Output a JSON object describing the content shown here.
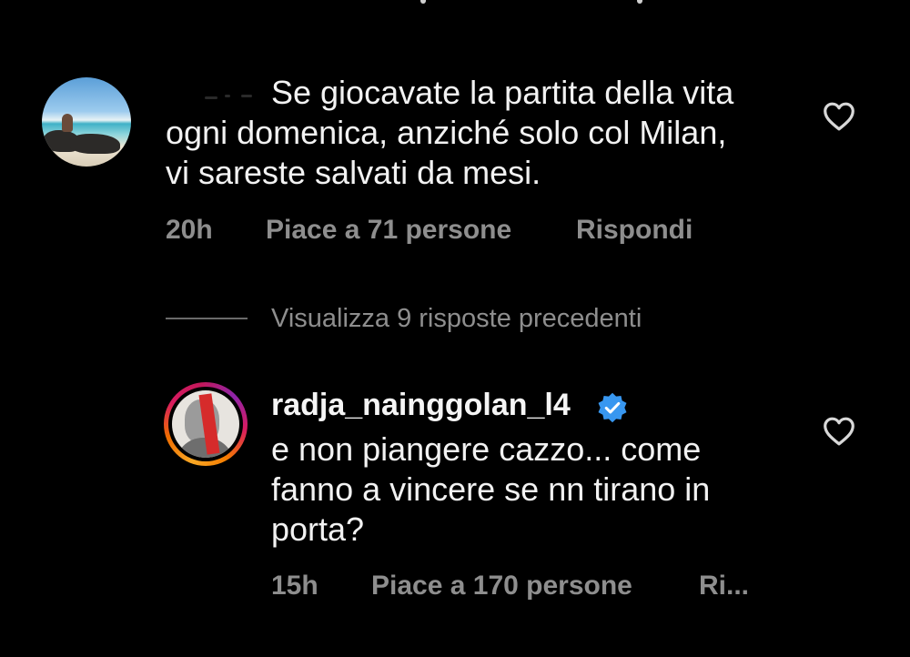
{
  "comments": [
    {
      "username": "",
      "text": "Se giocavate la partita della vita ogni domenica, anziché solo col Milan, vi sareste salvati da mesi.",
      "text_lines": [
        "Se giocavate la partita della vita",
        "ogni domenica, anziché solo col Milan,",
        "vi sareste salvati da mesi."
      ],
      "time": "20h",
      "likes": "Piace a 71 persone",
      "reply": "Rispondi",
      "liked": false,
      "icons": {
        "avatar": "avatar",
        "like": "heart-outline-icon"
      }
    },
    {
      "username": "radja_nainggolan_l4",
      "verified": true,
      "text_lines": [
        "e non piangere cazzo... come",
        "fanno a vincere se nn tirano in",
        "porta?"
      ],
      "time": "15h",
      "likes": "Piace a 170 persone",
      "reply": "Ri...",
      "liked": false,
      "icons": {
        "avatar": "story-ring-avatar",
        "verified": "verified-badge-icon",
        "like": "heart-outline-icon"
      }
    }
  ],
  "view_replies": "Visualizza 9 risposte precedenti",
  "colors": {
    "background": "#000000",
    "text": "#f2f2f2",
    "meta": "#8e8e8e",
    "verified": "#3897f0"
  }
}
